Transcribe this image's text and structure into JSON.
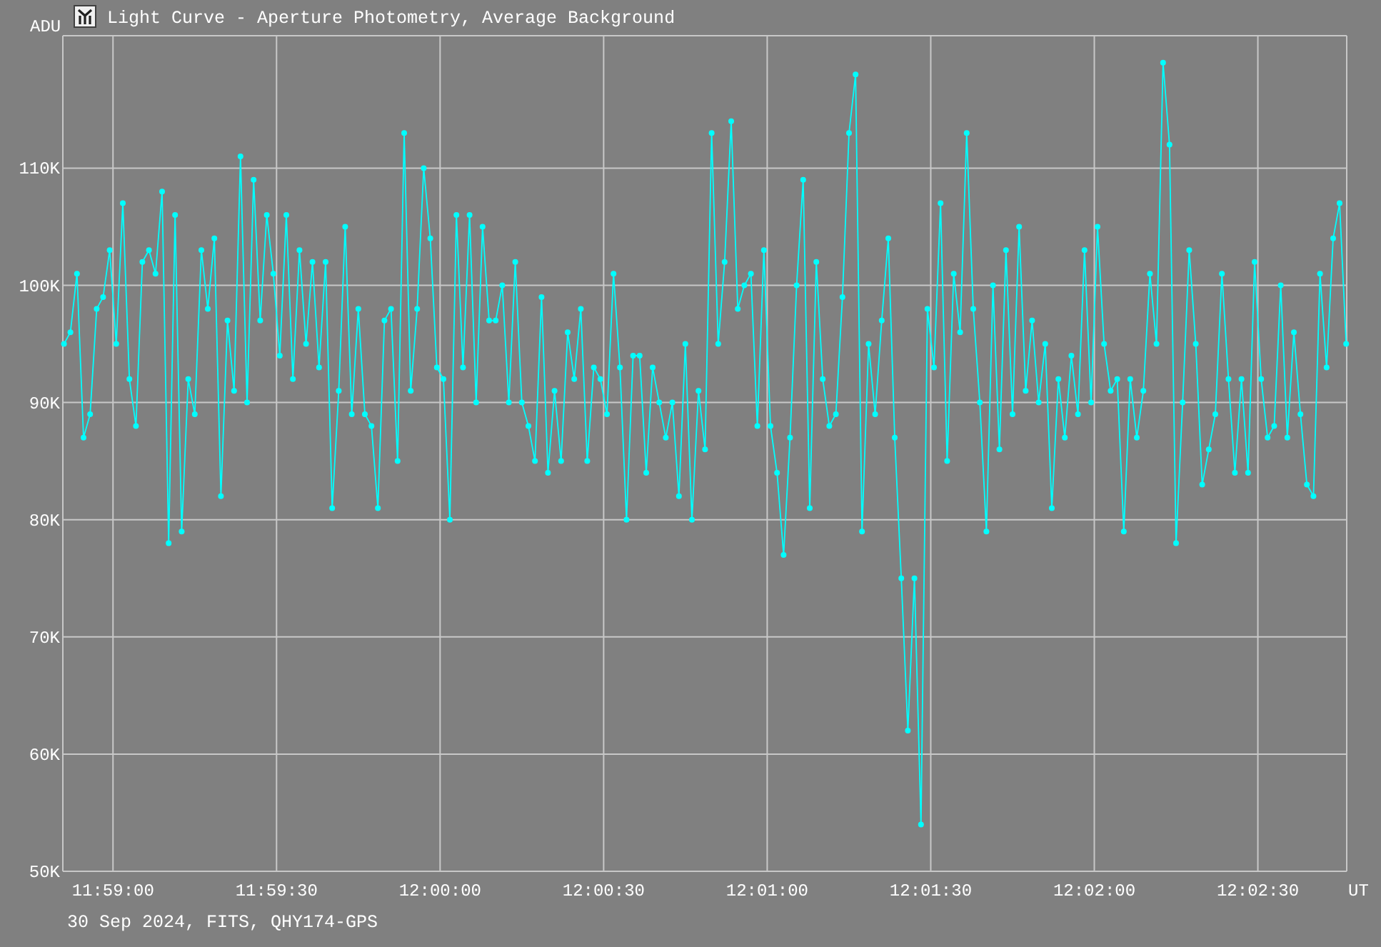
{
  "window": {
    "title": "Light Curve - Aperture Photometry, Average Background"
  },
  "chart": {
    "chart_data": {
      "type": "line",
      "ylabel": "ADU",
      "xlabel": "UT",
      "grid": true,
      "xlim": [
        43130.8,
        43366.3
      ],
      "ylim": [
        50,
        121.3
      ],
      "xticks": [
        {
          "value": 43140,
          "label": "11:59:00"
        },
        {
          "value": 43170,
          "label": "11:59:30"
        },
        {
          "value": 43200,
          "label": "12:00:00"
        },
        {
          "value": 43230,
          "label": "12:00:30"
        },
        {
          "value": 43260,
          "label": "12:01:00"
        },
        {
          "value": 43290,
          "label": "12:01:30"
        },
        {
          "value": 43320,
          "label": "12:02:00"
        },
        {
          "value": 43350,
          "label": "12:02:30"
        }
      ],
      "yticks": [
        {
          "value": 50,
          "label": "50K"
        },
        {
          "value": 60,
          "label": "60K"
        },
        {
          "value": 70,
          "label": "70K"
        },
        {
          "value": 80,
          "label": "80K"
        },
        {
          "value": 90,
          "label": "90K"
        },
        {
          "value": 100,
          "label": "100K"
        },
        {
          "value": 110,
          "label": "110K"
        }
      ],
      "x": [
        43131,
        43132.2,
        43133.4,
        43134.6,
        43135.8,
        43137,
        43138.2,
        43139.4,
        43140.6,
        43141.8,
        43143,
        43144.2,
        43145.4,
        43146.6,
        43147.8,
        43149,
        43150.2,
        43151.4,
        43152.6,
        43153.8,
        43155,
        43156.2,
        43157.4,
        43158.6,
        43159.8,
        43161,
        43162.2,
        43163.4,
        43164.6,
        43165.8,
        43167,
        43168.2,
        43169.4,
        43170.6,
        43171.8,
        43173,
        43174.2,
        43175.4,
        43176.6,
        43177.8,
        43179,
        43180.2,
        43181.4,
        43182.6,
        43183.8,
        43185,
        43186.2,
        43187.4,
        43188.6,
        43189.8,
        43191,
        43192.2,
        43193.4,
        43194.6,
        43195.8,
        43197,
        43198.2,
        43199.4,
        43200.6,
        43201.8,
        43203,
        43204.2,
        43205.4,
        43206.6,
        43207.8,
        43209,
        43210.2,
        43211.4,
        43212.6,
        43213.8,
        43215,
        43216.2,
        43217.4,
        43218.6,
        43219.8,
        43221,
        43222.2,
        43223.4,
        43224.6,
        43225.8,
        43227,
        43228.2,
        43229.4,
        43230.6,
        43231.8,
        43233,
        43234.2,
        43235.4,
        43236.6,
        43237.8,
        43239,
        43240.2,
        43241.4,
        43242.6,
        43243.8,
        43245,
        43246.2,
        43247.4,
        43248.6,
        43249.8,
        43251,
        43252.2,
        43253.4,
        43254.6,
        43255.8,
        43257,
        43258.2,
        43259.4,
        43260.6,
        43261.8,
        43263,
        43264.2,
        43265.4,
        43266.6,
        43267.8,
        43269,
        43270.2,
        43271.4,
        43272.6,
        43273.8,
        43275,
        43276.2,
        43277.4,
        43278.6,
        43279.8,
        43281,
        43282.2,
        43283.4,
        43284.6,
        43285.8,
        43287,
        43288.2,
        43289.4,
        43290.6,
        43291.8,
        43293,
        43294.2,
        43295.4,
        43296.6,
        43297.8,
        43299,
        43300.2,
        43301.4,
        43302.6,
        43303.8,
        43305,
        43306.2,
        43307.4,
        43308.6,
        43309.8,
        43311,
        43312.2,
        43313.4,
        43314.6,
        43315.8,
        43317,
        43318.2,
        43319.4,
        43320.6,
        43321.8,
        43323,
        43324.2,
        43325.4,
        43326.6,
        43327.8,
        43329,
        43330.2,
        43331.4,
        43332.6,
        43333.8,
        43335,
        43336.2,
        43337.4,
        43338.6,
        43339.8,
        43341,
        43342.2,
        43343.4,
        43344.6,
        43345.8,
        43347,
        43348.2,
        43349.4,
        43350.6,
        43351.8,
        43353,
        43354.2,
        43355.4,
        43356.6,
        43357.8,
        43359,
        43360.2,
        43361.4,
        43362.6,
        43363.8,
        43365,
        43366.2
      ],
      "series": [
        {
          "color": "#00ffff",
          "marker": "circle",
          "values": [
            95,
            96,
            101,
            87,
            89,
            98,
            99,
            103,
            95,
            107,
            92,
            88,
            102,
            103,
            101,
            108,
            78,
            106,
            79,
            92,
            89,
            103,
            98,
            104,
            82,
            97,
            91,
            111,
            90,
            109,
            97,
            106,
            101,
            94,
            106,
            92,
            103,
            95,
            102,
            93,
            102,
            81,
            91,
            105,
            89,
            98,
            89,
            88,
            81,
            97,
            98,
            85,
            113,
            91,
            98,
            110,
            104,
            93,
            92,
            80,
            106,
            93,
            106,
            90,
            105,
            97,
            97,
            100,
            90,
            102,
            90,
            88,
            85,
            99,
            84,
            91,
            85,
            96,
            92,
            98,
            85,
            93,
            92,
            89,
            101,
            93,
            80,
            94,
            94,
            84,
            93,
            90,
            87,
            90,
            82,
            95,
            80,
            91,
            86,
            113,
            95,
            102,
            114,
            98,
            100,
            101,
            88,
            103,
            88,
            84,
            77,
            87,
            100,
            109,
            81,
            102,
            92,
            88,
            89,
            99,
            113,
            118,
            79,
            95,
            89,
            97,
            104,
            87,
            75,
            62,
            75,
            54,
            98,
            93,
            107,
            85,
            101,
            96,
            113,
            98,
            90,
            79,
            100,
            86,
            103,
            89,
            105,
            91,
            97,
            90,
            95,
            81,
            92,
            87,
            94,
            89,
            103,
            90,
            105,
            95,
            91,
            92,
            79,
            92,
            87,
            91,
            101,
            95,
            119,
            112,
            78,
            90,
            103,
            95,
            83,
            86,
            89,
            101,
            92,
            84,
            92,
            84,
            102,
            92,
            87,
            88,
            100,
            87,
            96,
            89,
            83,
            82,
            101,
            93,
            104,
            107,
            95
          ]
        }
      ]
    }
  },
  "footer": "30 Sep 2024, FITS, QHY174-GPS"
}
